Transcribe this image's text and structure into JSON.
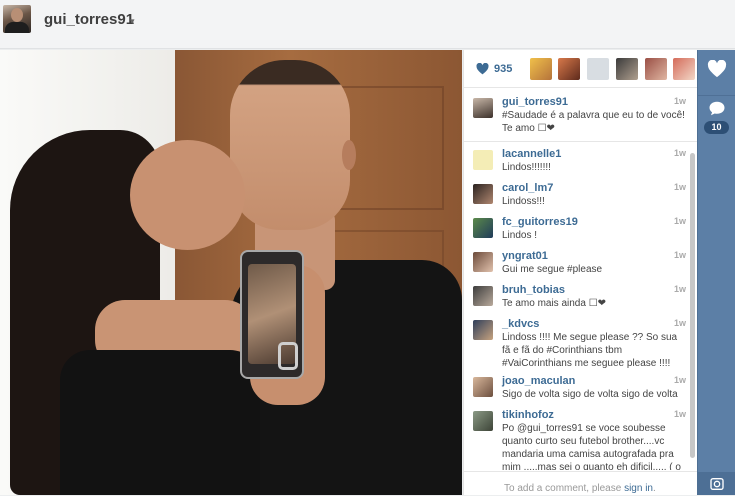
{
  "header": {
    "username": "gui_torres91",
    "dropdown_icon": "▾"
  },
  "post": {
    "like_count": "935",
    "comment_count": "10",
    "comment_prompt_prefix": "To add a comment, please ",
    "comment_prompt_link": "sign in",
    "comment_prompt_suffix": "."
  },
  "comments": [
    {
      "user": "gui_torres91",
      "time": "1w",
      "text": "#Saudade é a palavra que eu to de você! Te amo ☐❤"
    },
    {
      "user": "lacannelle1",
      "time": "1w",
      "text": "Lindos!!!!!!!"
    },
    {
      "user": "carol_lm7",
      "time": "1w",
      "text": "Lindoss!!!"
    },
    {
      "user": "fc_guitorres19",
      "time": "1w",
      "text": "Lindos !"
    },
    {
      "user": "yngrat01",
      "time": "1w",
      "text": "Gui me segue #please"
    },
    {
      "user": "bruh_tobias",
      "time": "1w",
      "text": "Te amo mais ainda ☐❤"
    },
    {
      "user": "_kdvcs",
      "time": "1w",
      "text": "Lindoss !!!! Me segue please ?? So sua fã e fã do #Corinthians tbm #VaiCorinthians me seguee please !!!!"
    },
    {
      "user": "joao_maculan",
      "time": "1w",
      "text": "Sigo de volta sigo de volta sigo de volta"
    },
    {
      "user": "tikinhofoz",
      "time": "1w",
      "text": "Po @gui_torres91 se voce soubesse quanto curto seu futebol brother....vc mandaria uma camisa autografada pra mim .....mas sei o quanto eh dificil..... ( o"
    }
  ],
  "colors": {
    "accent": "#3d6b94",
    "action_bar": "#5c7fa6"
  },
  "icons": {
    "like": "heart-icon",
    "comment": "speech-bubble-icon",
    "profile_mini": "camera-icon"
  }
}
